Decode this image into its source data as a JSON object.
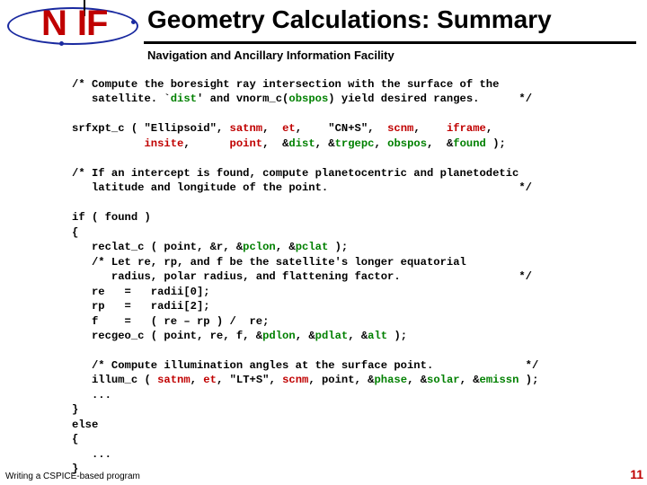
{
  "logo": {
    "n": "N",
    "if": "IF"
  },
  "title": "Geometry Calculations: Summary",
  "subtitle": "Navigation and Ancillary Information Facility",
  "footer": "Writing a CSPICE-based program",
  "pagenum": "11",
  "code": {
    "c1a": "/* Compute the boresight ray intersection with the surface of the",
    "c1b": "   satellite. `",
    "dist": "dist",
    "c1c": "' and vnorm_c(",
    "obspos": "obspos",
    "c1d": ") yield desired ranges.      */",
    "srf": "srfxpt_c ( \"Ellipsoid\", ",
    "satnm1": "satnm",
    "srf2": ",  ",
    "et1": "et",
    "srf3": ",    \"CN+S\",  ",
    "scnm1": "scnm",
    "srf4": ",    ",
    "iframe": "iframe",
    "srf5": ",",
    "srfl2a": "           ",
    "insite": "insite",
    "srfl2b": ",      ",
    "point1": "point",
    "srfl2c": ",  &",
    "dist2": "dist",
    "srfl2d": ", &",
    "trgepc": "trgepc",
    "srfl2e": ", ",
    "obspos2": "obspos",
    "srfl2f": ",  &",
    "found": "found",
    "srfl2g": " );",
    "c2a": "/* If an intercept is found, compute planetocentric and planetodetic",
    "c2b": "   latitude and longitude of the point.                             */",
    "iff": "if ( found )",
    "ob": "{",
    "rec": "   reclat_c ( point, &r, &",
    "pclon": "pclon",
    "rec2": ", &",
    "pclat": "pclat",
    "rec3": " );",
    "c3a": "   /* Let re, rp, and f be the satellite's longer equatorial",
    "c3b": "      radius, polar radius, and flattening factor.                  */",
    "re": "   re   =   radii[0];",
    "rp": "   rp   =   radii[2];",
    "f": "   f    =   ( re – rp ) /  re;",
    "recg": "   recgeo_c ( point, re, f, &",
    "pdlon": "pdlon",
    "recg2": ", &",
    "pdlat": "pdlat",
    "recg3": ", &",
    "alt": "alt",
    "recg4": " );",
    "c4": "   /* Compute illumination angles at the surface point.              */",
    "ill": "   illum_c ( ",
    "satnm2": "satnm",
    "ill2": ", ",
    "et2": "et",
    "ill3": ", \"LT+S\", ",
    "scnm2": "scnm",
    "ill4": ", point, &",
    "phase": "phase",
    "ill5": ", &",
    "solar": "solar",
    "ill6": ", &",
    "emissn": "emissn",
    "ill7": " );",
    "dots1": "   ...",
    "cb": "}",
    "else": "else",
    "ob2": "{",
    "dots2": "   ...",
    "cb2": "}"
  }
}
